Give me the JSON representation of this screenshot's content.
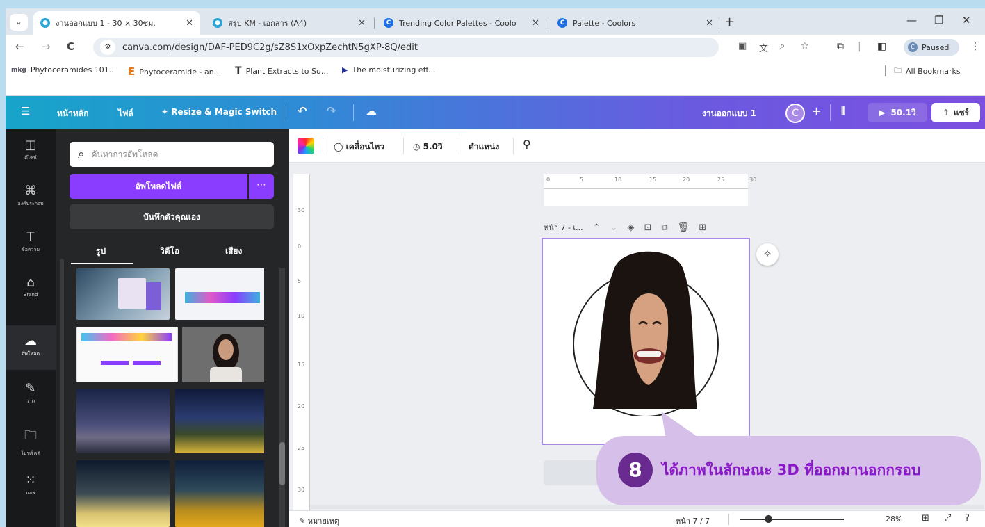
{
  "browser": {
    "tabs": [
      {
        "title": "งานออกแบบ 1 - 30 × 30ซม.",
        "active": true
      },
      {
        "title": "สรุป KM - เอกสาร (A4)",
        "active": false
      },
      {
        "title": "Trending Color Palettes - Coolo",
        "active": false
      },
      {
        "title": "Palette - Coolors",
        "active": false
      }
    ],
    "url": "canva.com/design/DAF-PED9C2g/sZ8S1xOxpZechtN5gXP-8Q/edit",
    "profile_status": "Paused",
    "bookmarks": [
      "Phytoceramides 101...",
      "Phytoceramide - an...",
      "Plant Extracts to Su...",
      "The moisturizing eff..."
    ],
    "all_bookmarks": "All Bookmarks"
  },
  "canva_header": {
    "home": "หน้าหลัก",
    "file": "ไฟล์",
    "resize": "Resize & Magic Switch",
    "design_title": "งานออกแบบ 1",
    "avatar_letter": "C",
    "present_time": "50.1วิ",
    "share": "แชร์"
  },
  "rail": {
    "items": [
      {
        "label": "ดีไซน์",
        "icon": "layout-icon"
      },
      {
        "label": "องค์ประกอบ",
        "icon": "elements-icon"
      },
      {
        "label": "ข้อความ",
        "icon": "text-icon"
      },
      {
        "label": "Brand",
        "icon": "brand-icon"
      },
      {
        "label": "อัพโหลด",
        "icon": "upload-cloud-icon"
      },
      {
        "label": "วาด",
        "icon": "draw-icon"
      },
      {
        "label": "โปรเจ็คต์",
        "icon": "folder-icon"
      },
      {
        "label": "แอพ",
        "icon": "apps-icon"
      }
    ]
  },
  "panel": {
    "search_placeholder": "ค้นหาการอัพโหลด",
    "upload_button": "อัพโหลดไฟล์",
    "record_button": "บันทึกตัวคุณเอง",
    "tabs": [
      "รูป",
      "วิดีโอ",
      "เสียง"
    ]
  },
  "toolbar": {
    "animate": "เคลื่อนไหว",
    "duration": "5.0วิ",
    "position": "ตำแหน่ง"
  },
  "ruler": {
    "h_ticks": [
      "0",
      "5",
      "10",
      "15",
      "20",
      "25",
      "30"
    ],
    "v_ticks": [
      "30",
      "0",
      "5",
      "10",
      "15",
      "20",
      "25",
      "30"
    ]
  },
  "page": {
    "label": "หน้า 7 - เ..."
  },
  "footer": {
    "notes": "หมายเหตุ",
    "page_count": "หน้า 7 / 7",
    "zoom": "28%"
  },
  "callout": {
    "number": "8",
    "text": "ได้ภาพในลักษณะ 3D ที่ออกมานอกกรอบ"
  }
}
